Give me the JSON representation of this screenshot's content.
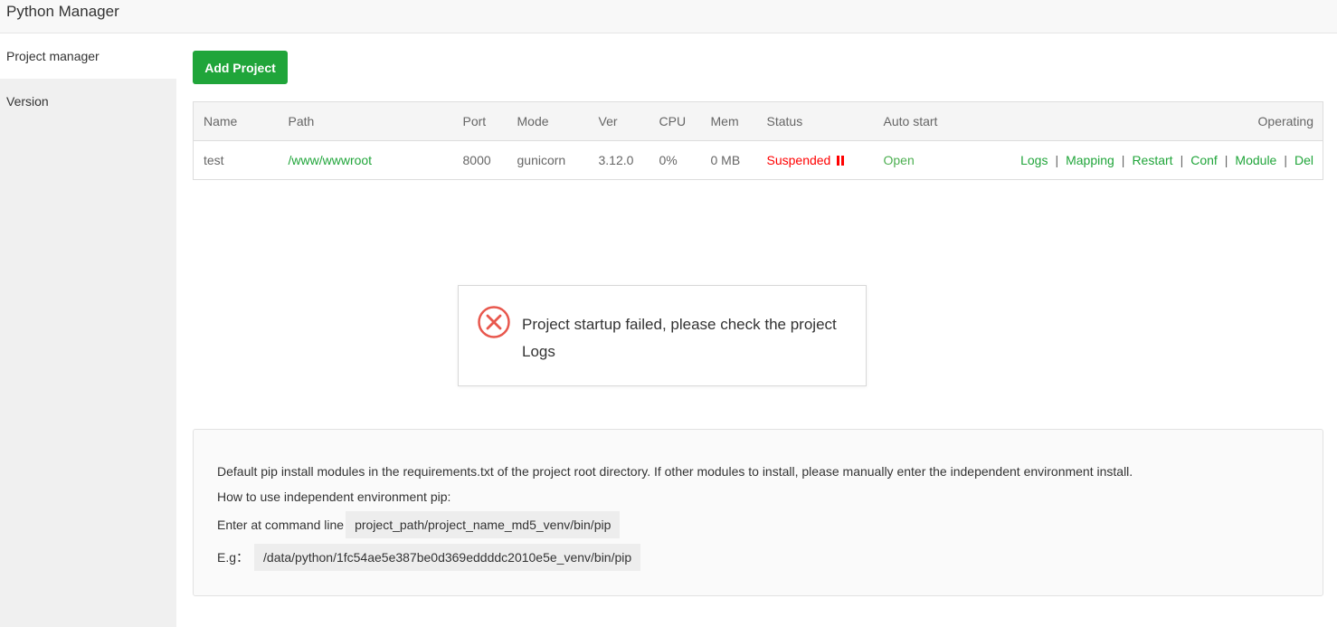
{
  "app": {
    "title": "Python Manager"
  },
  "sidebar": {
    "items": [
      {
        "label": "Project manager"
      },
      {
        "label": "Version"
      }
    ]
  },
  "toolbar": {
    "add_label": "Add Project"
  },
  "table": {
    "headers": [
      "Name",
      "Path",
      "Port",
      "Mode",
      "Ver",
      "CPU",
      "Mem",
      "Status",
      "Auto start",
      "Operating"
    ],
    "rows": [
      {
        "name": "test",
        "path": "/www/wwwroot",
        "port": "8000",
        "mode": "gunicorn",
        "ver": "3.12.0",
        "cpu": "0%",
        "mem": "0 MB",
        "status": "Suspended",
        "auto_start": "Open",
        "ops": [
          "Logs",
          "Mapping",
          "Restart",
          "Conf",
          "Module",
          "Del"
        ],
        "sep": "|"
      }
    ]
  },
  "toast": {
    "message": "Project startup failed, please check the project Logs",
    "icon": "error-circle-icon"
  },
  "info": {
    "line1": "Default pip install modules in the requirements.txt of the project root directory. If other modules to install, please manually enter the independent environment install.",
    "line2": "How to use independent environment pip:",
    "line3_label": "Enter at command line",
    "line3_code": "project_path/project_name_md5_venv/bin/pip",
    "line4_label": "E.g：",
    "line4_code": "/data/python/1fc54ae5e387be0d369eddddc2010e5e_venv/bin/pip"
  },
  "colors": {
    "accent": "#20a53a",
    "danger": "#ff0000"
  }
}
